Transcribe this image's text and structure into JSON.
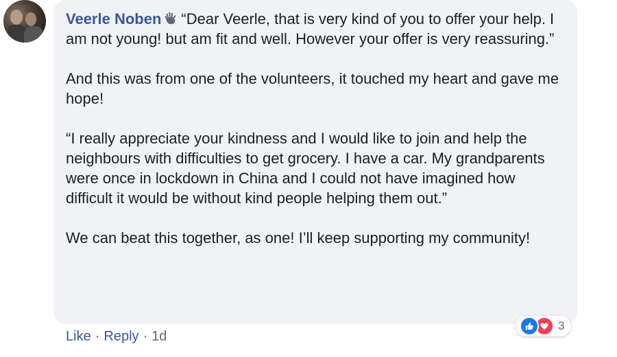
{
  "comment": {
    "author": "Veerle Noben",
    "paragraphs": [
      "“Dear Veerle, that is very kind of you to offer your help. I am not young! but am fit and well. However your offer is very reassuring.”",
      "And this was from one of the volunteers, it touched my heart and gave me hope!",
      "“I really appreciate your kindness and I would like to join and help the neighbours with difficulties to get grocery. I have a car. My grandparents were once in lockdown in China and I could not have imagined how difficult it would be without kind people helping them out.”",
      "We can beat this together, as one! I’ll keep supporting my community!"
    ]
  },
  "actions": {
    "like_label": "Like",
    "reply_label": "Reply",
    "separator": "·",
    "time": "1d"
  },
  "reactions": {
    "icons": [
      "like-icon",
      "love-icon"
    ],
    "count": "3",
    "like_color": "#1877f2",
    "love_color": "#f33e58"
  },
  "colors": {
    "author": "#385898",
    "bubble": "#f0f2f5",
    "text": "#1c1e21"
  }
}
